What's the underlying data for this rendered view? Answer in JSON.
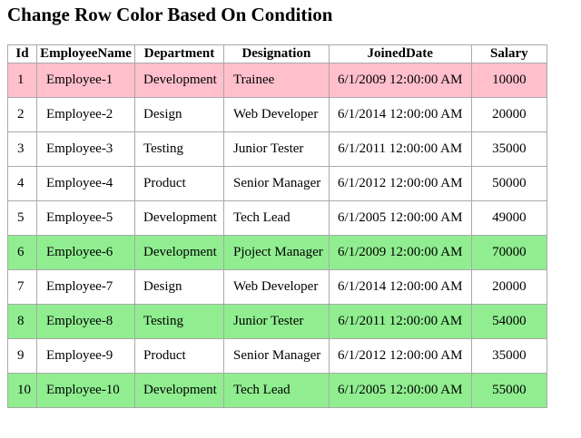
{
  "page": {
    "title": "Change Row Color Based On Condition"
  },
  "colors": {
    "pink": "#ffc0cb",
    "green": "#90ee90",
    "border": "#a9a9a9"
  },
  "table": {
    "headers": {
      "id": "Id",
      "name": "EmployeeName",
      "department": "Department",
      "designation": "Designation",
      "joined": "JoinedDate",
      "salary": "Salary"
    },
    "rows": [
      {
        "id": "1",
        "name": "Employee-1",
        "department": "Development",
        "designation": "Trainee",
        "joined": "6/1/2009 12:00:00 AM",
        "salary": "10000",
        "highlight": "pink"
      },
      {
        "id": "2",
        "name": "Employee-2",
        "department": "Design",
        "designation": "Web Developer",
        "joined": "6/1/2014 12:00:00 AM",
        "salary": "20000",
        "highlight": "none"
      },
      {
        "id": "3",
        "name": "Employee-3",
        "department": "Testing",
        "designation": "Junior Tester",
        "joined": "6/1/2011 12:00:00 AM",
        "salary": "35000",
        "highlight": "none"
      },
      {
        "id": "4",
        "name": "Employee-4",
        "department": "Product",
        "designation": "Senior Manager",
        "joined": "6/1/2012 12:00:00 AM",
        "salary": "50000",
        "highlight": "none"
      },
      {
        "id": "5",
        "name": "Employee-5",
        "department": "Development",
        "designation": "Tech Lead",
        "joined": "6/1/2005 12:00:00 AM",
        "salary": "49000",
        "highlight": "none"
      },
      {
        "id": "6",
        "name": "Employee-6",
        "department": "Development",
        "designation": "Pjoject Manager",
        "joined": "6/1/2009 12:00:00 AM",
        "salary": "70000",
        "highlight": "green"
      },
      {
        "id": "7",
        "name": "Employee-7",
        "department": "Design",
        "designation": "Web Developer",
        "joined": "6/1/2014 12:00:00 AM",
        "salary": "20000",
        "highlight": "none"
      },
      {
        "id": "8",
        "name": "Employee-8",
        "department": "Testing",
        "designation": "Junior Tester",
        "joined": "6/1/2011 12:00:00 AM",
        "salary": "54000",
        "highlight": "green"
      },
      {
        "id": "9",
        "name": "Employee-9",
        "department": "Product",
        "designation": "Senior Manager",
        "joined": "6/1/2012 12:00:00 AM",
        "salary": "35000",
        "highlight": "none"
      },
      {
        "id": "10",
        "name": "Employee-10",
        "department": "Development",
        "designation": "Tech Lead",
        "joined": "6/1/2005 12:00:00 AM",
        "salary": "55000",
        "highlight": "green"
      }
    ]
  }
}
